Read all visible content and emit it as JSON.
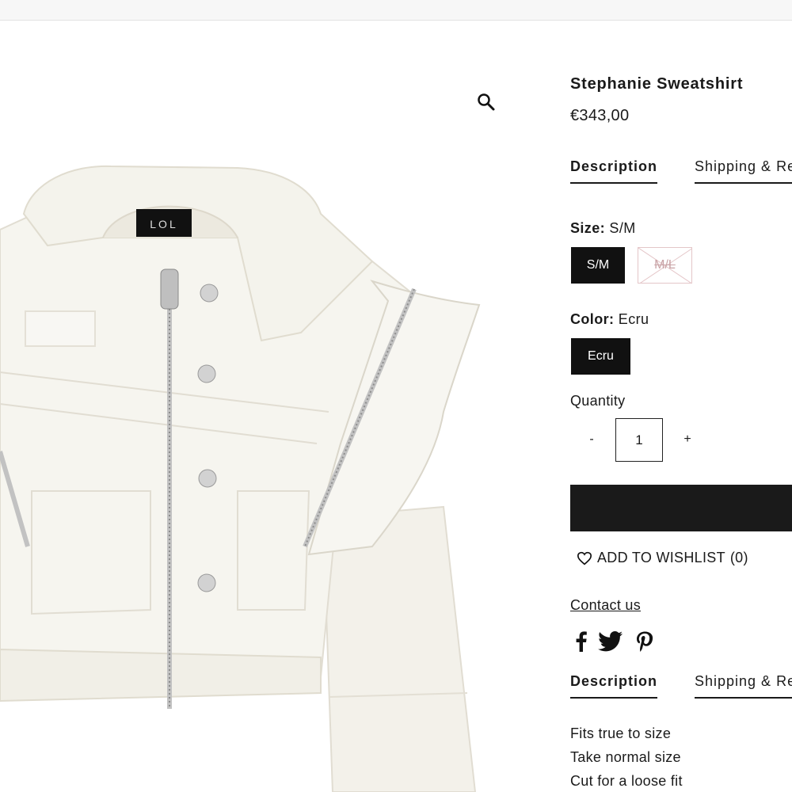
{
  "product": {
    "title": "Stephanie Sweatshirt",
    "price": "€343,00",
    "image_brand_label": "LOL"
  },
  "tabs_top": [
    {
      "label": "Description",
      "active": true
    },
    {
      "label": "Shipping & Returns",
      "active": false
    }
  ],
  "size": {
    "label": "Size:",
    "selected": "S/M",
    "options": [
      {
        "label": "S/M",
        "selected": true,
        "available": true
      },
      {
        "label": "M/L",
        "selected": false,
        "available": false
      }
    ]
  },
  "color": {
    "label": "Color:",
    "selected": "Ecru",
    "options": [
      {
        "label": "Ecru",
        "selected": true,
        "available": true
      }
    ]
  },
  "quantity": {
    "label": "Quantity",
    "minus": "-",
    "value": "1",
    "plus": "+"
  },
  "wishlist": {
    "label": "ADD TO WISHLIST",
    "count": "(0)"
  },
  "contact_link": "Contact us",
  "social_icons": [
    "facebook-icon",
    "twitter-icon",
    "pinterest-icon"
  ],
  "tabs_bottom": [
    {
      "label": "Description",
      "active": true
    },
    {
      "label": "Shipping & Returns",
      "active": false
    }
  ],
  "description_lines": [
    "Fits true to size",
    "Take normal size",
    "Cut for a loose fit"
  ],
  "colors": {
    "selected_swatch_bg": "#111111",
    "disabled_swatch_text": "#c9a3a6",
    "cart_button_bg": "#1a1a1a"
  }
}
